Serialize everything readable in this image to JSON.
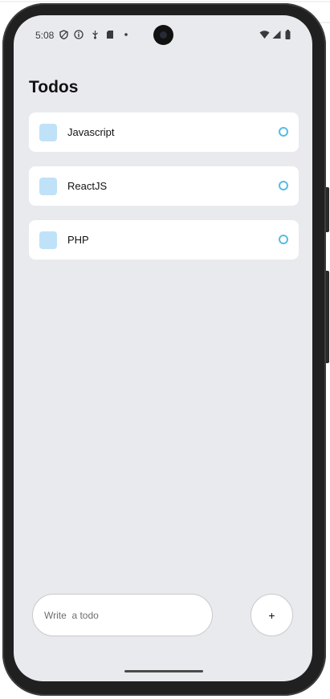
{
  "status_bar": {
    "time": "5:08",
    "left_icons": [
      "shield-icon",
      "info-icon",
      "usb-debug-icon",
      "sd-card-icon",
      "notification-dot-icon"
    ],
    "right_icons": [
      "wifi-icon",
      "signal-icon",
      "battery-icon"
    ]
  },
  "page": {
    "title": "Todos"
  },
  "todos": [
    {
      "label": "Javascript"
    },
    {
      "label": "ReactJS"
    },
    {
      "label": "PHP"
    }
  ],
  "composer": {
    "placeholder": "Write  a todo",
    "add_label": "+"
  },
  "colors": {
    "screen_bg": "#e9eaee",
    "card_bg": "#ffffff",
    "checkbox": "#bfe2f8",
    "accent": "#55bce6"
  }
}
